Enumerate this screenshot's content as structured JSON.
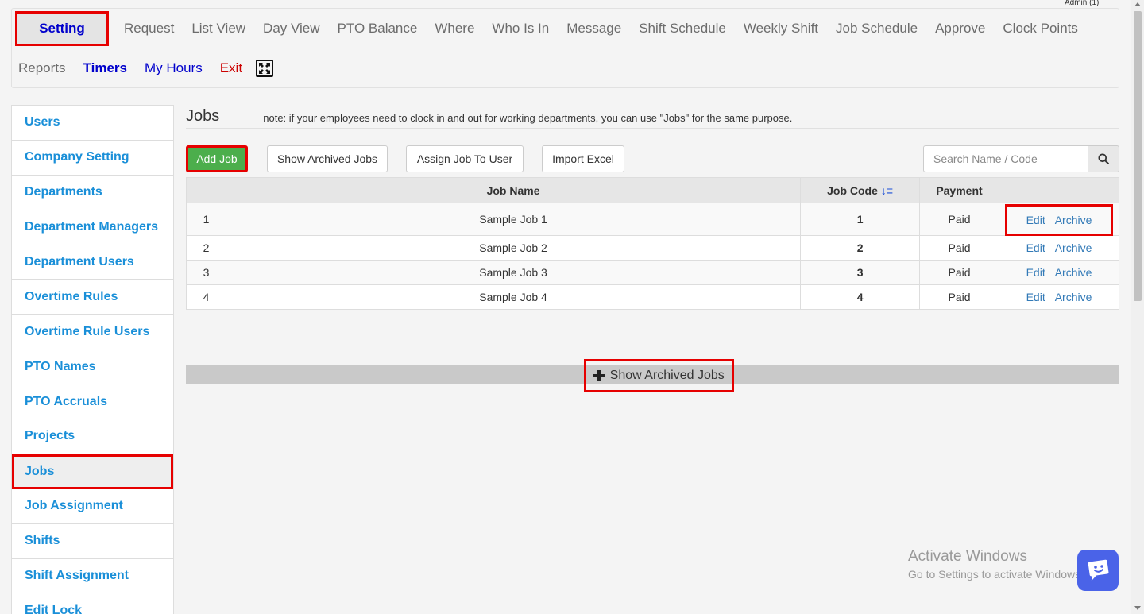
{
  "admin": "Admin (1)",
  "nav": {
    "row1": [
      "Setting",
      "Request",
      "List View",
      "Day View",
      "PTO Balance",
      "Where",
      "Who Is In",
      "Message",
      "Shift Schedule",
      "Weekly Shift",
      "Job Schedule",
      "Approve",
      "Clock Points"
    ],
    "row2": [
      "Reports",
      "Timers",
      "My Hours",
      "Exit"
    ]
  },
  "sidebar": {
    "items": [
      "Users",
      "Company Setting",
      "Departments",
      "Department Managers",
      "Department Users",
      "Overtime Rules",
      "Overtime Rule Users",
      "PTO Names",
      "PTO Accruals",
      "Projects",
      "Jobs",
      "Job Assignment",
      "Shifts",
      "Shift Assignment",
      "Edit Lock"
    ],
    "active": "Jobs"
  },
  "main": {
    "title": "Jobs",
    "note": "note: if your employees need to clock in and out for working departments, you can use \"Jobs\" for the same purpose.",
    "buttons": {
      "add_job": "Add Job",
      "show_archived": "Show Archived Jobs",
      "assign_job": "Assign Job To User",
      "import_excel": "Import Excel"
    },
    "search_placeholder": "Search Name / Code",
    "table": {
      "headers": [
        "",
        "Job Name",
        "Job Code",
        "Payment",
        ""
      ],
      "rows": [
        {
          "idx": "1",
          "name": "Sample Job 1",
          "code": "1",
          "payment": "Paid"
        },
        {
          "idx": "2",
          "name": "Sample Job 2",
          "code": "2",
          "payment": "Paid"
        },
        {
          "idx": "3",
          "name": "Sample Job 3",
          "code": "3",
          "payment": "Paid"
        },
        {
          "idx": "4",
          "name": "Sample Job 4",
          "code": "4",
          "payment": "Paid"
        }
      ],
      "edit_label": "Edit",
      "archive_label": "Archive"
    },
    "archived_link": " Show Archived Jobs"
  },
  "watermark": {
    "line1": "Activate Windows",
    "line2": "Go to Settings to activate Windows."
  },
  "colors": {
    "highlight": "#e60000",
    "link": "#337ab7",
    "nav_active": "#0000cc",
    "sidebar_link": "#1a8fd8",
    "add_button": "#4cae4c",
    "chat": "#4a63e8"
  }
}
